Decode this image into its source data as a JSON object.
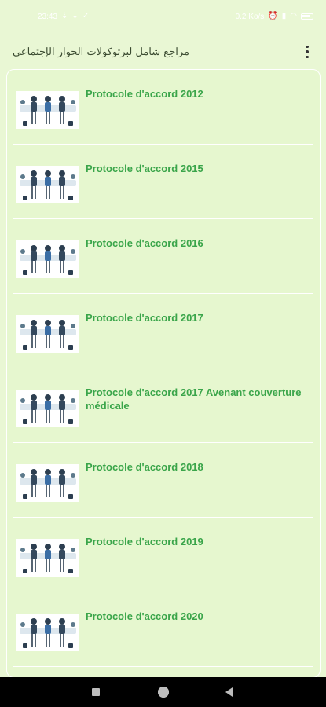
{
  "status_bar": {
    "time": "23:43",
    "network_speed": "0.2 Ko/s",
    "battery_icon": "battery-icon"
  },
  "toolbar": {
    "title": "مراجع شامل لبرتوكولات الحوار الإجتماعي",
    "menu_icon": "more-vert-icon"
  },
  "list": {
    "items": [
      {
        "title": "Protocole d'accord 2012",
        "thumb_icon": "meeting-people-icon"
      },
      {
        "title": "Protocole d'accord 2015",
        "thumb_icon": "meeting-people-icon"
      },
      {
        "title": "Protocole d'accord 2016",
        "thumb_icon": "meeting-people-icon"
      },
      {
        "title": "Protocole d'accord 2017",
        "thumb_icon": "meeting-people-icon"
      },
      {
        "title": " Protocole d'accord 2017 Avenant couverture médicale",
        "thumb_icon": "meeting-people-icon"
      },
      {
        "title": "Protocole d'accord 2018",
        "thumb_icon": "meeting-people-icon"
      },
      {
        "title": "Protocole d'accord 2019",
        "thumb_icon": "meeting-people-icon"
      },
      {
        "title": "Protocole d'accord 2020",
        "thumb_icon": "meeting-people-icon"
      }
    ]
  },
  "colors": {
    "background": "#e9f7d4",
    "item_title": "#3aa54a",
    "nav_bar": "#000000"
  }
}
